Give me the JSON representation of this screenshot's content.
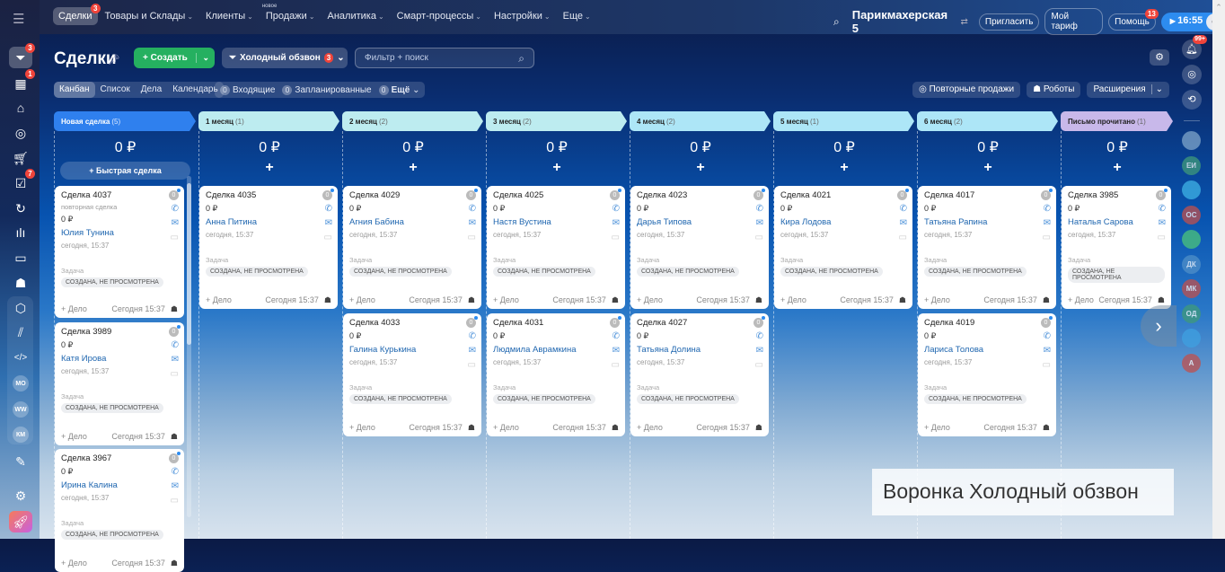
{
  "topnav": {
    "items": [
      {
        "label": "Сделки",
        "badge": "3",
        "active": true
      },
      {
        "label": "Товары и Склады",
        "chevron": true
      },
      {
        "label": "Клиенты",
        "chevron": true
      },
      {
        "label": "Продажи",
        "chevron": true,
        "tag": "новое"
      },
      {
        "label": "Аналитика",
        "chevron": true
      },
      {
        "label": "Смарт-процессы",
        "chevron": true
      },
      {
        "label": "Настройки",
        "chevron": true
      },
      {
        "label": "Еще",
        "chevron": true
      }
    ],
    "company": "Парикмахерская 5",
    "invite": "Пригласить",
    "tariff": "Мой тариф",
    "help": "Помощь",
    "help_badge": "13",
    "clock": "16:55"
  },
  "sidebar": {
    "deals_badge": "3",
    "tasks_badge": "1",
    "todo_badge": "7",
    "avatars": [
      "МО",
      "WW",
      "КМ"
    ]
  },
  "header": {
    "title": "Сделки",
    "create": "Создать",
    "funnel": "Холодный обзвон",
    "funnel_badge": "3",
    "search_placeholder": "Фильтр + поиск",
    "views": [
      "Канбан",
      "Список",
      "Дела",
      "Календарь"
    ],
    "counters": [
      {
        "n": "0",
        "label": "Входящие"
      },
      {
        "n": "0",
        "label": "Запланированные"
      },
      {
        "n": "0",
        "label": "Ещё"
      }
    ],
    "repeat_sales": "Повторные продажи",
    "robots": "Роботы",
    "extensions": "Расширения"
  },
  "columns": [
    {
      "title": "Новая сделка",
      "count": "(5)",
      "sum": "0 ₽",
      "color": "#2f80ee",
      "quick": "Быстрая сделка",
      "cards": [
        {
          "title": "Сделка 4037",
          "sub": "повторная сделка",
          "amount": "0 ₽",
          "contact": "Юлия Тунина",
          "date": "сегодня, 15:37",
          "task": "Задача",
          "status": "СОЗДАНА, НЕ ПРОСМОТРЕНА",
          "add": "+ Дело",
          "foot": "Сегодня 15:37",
          "counter": "0"
        },
        {
          "title": "Сделка 3989",
          "amount": "0 ₽",
          "contact": "Катя Ирова",
          "date": "сегодня, 15:37",
          "task": "Задача",
          "status": "СОЗДАНА, НЕ ПРОСМОТРЕНА",
          "add": "+ Дело",
          "foot": "Сегодня 15:37",
          "counter": "0"
        },
        {
          "title": "Сделка 3967",
          "amount": "0 ₽",
          "contact": "Ирина Калина",
          "date": "сегодня, 15:37",
          "task": "Задача",
          "status": "СОЗДАНА, НЕ ПРОСМОТРЕНА",
          "add": "+ Дело",
          "foot": "Сегодня 15:37",
          "counter": "0"
        }
      ]
    },
    {
      "title": "1 месяц",
      "count": "(1)",
      "sum": "0 ₽",
      "color": "#bdecf0",
      "cards": [
        {
          "title": "Сделка 4035",
          "amount": "0 ₽",
          "contact": "Анна Питина",
          "date": "сегодня, 15:37",
          "task": "Задача",
          "status": "СОЗДАНА, НЕ ПРОСМОТРЕНА",
          "add": "+ Дело",
          "foot": "Сегодня 15:37",
          "counter": "0"
        }
      ]
    },
    {
      "title": "2 месяц",
      "count": "(2)",
      "sum": "0 ₽",
      "color": "#bdecf0",
      "cards": [
        {
          "title": "Сделка 4029",
          "amount": "0 ₽",
          "contact": "Агния Бабина",
          "date": "сегодня, 15:37",
          "task": "Задача",
          "status": "СОЗДАНА, НЕ ПРОСМОТРЕНА",
          "add": "+ Дело",
          "foot": "Сегодня 15:37",
          "counter": "0"
        },
        {
          "title": "Сделка 4033",
          "amount": "0 ₽",
          "contact": "Галина Курькина",
          "date": "сегодня, 15:37",
          "task": "Задача",
          "status": "СОЗДАНА, НЕ ПРОСМОТРЕНА",
          "add": "+ Дело",
          "foot": "Сегодня 15:37",
          "counter": "0"
        }
      ]
    },
    {
      "title": "3 месяц",
      "count": "(2)",
      "sum": "0 ₽",
      "color": "#bdecf0",
      "cards": [
        {
          "title": "Сделка 4025",
          "amount": "0 ₽",
          "contact": "Настя Вустина",
          "date": "сегодня, 15:37",
          "task": "Задача",
          "status": "СОЗДАНА, НЕ ПРОСМОТРЕНА",
          "add": "+ Дело",
          "foot": "Сегодня 15:37",
          "counter": "0"
        },
        {
          "title": "Сделка 4031",
          "amount": "0 ₽",
          "contact": "Людмила Аврамкина",
          "date": "сегодня, 15:37",
          "task": "Задача",
          "status": "СОЗДАНА, НЕ ПРОСМОТРЕНА",
          "add": "+ Дело",
          "foot": "Сегодня 15:37",
          "counter": "0"
        }
      ]
    },
    {
      "title": "4 месяц",
      "count": "(2)",
      "sum": "0 ₽",
      "color": "#ade6f7",
      "cards": [
        {
          "title": "Сделка 4023",
          "amount": "0 ₽",
          "contact": "Дарья Типова",
          "date": "сегодня, 15:37",
          "task": "Задача",
          "status": "СОЗДАНА, НЕ ПРОСМОТРЕНА",
          "add": "+ Дело",
          "foot": "Сегодня 15:37",
          "counter": "0"
        },
        {
          "title": "Сделка 4027",
          "amount": "0 ₽",
          "contact": "Татьяна Долина",
          "date": "сегодня, 15:37",
          "task": "Задача",
          "status": "СОЗДАНА, НЕ ПРОСМОТРЕНА",
          "add": "+ Дело",
          "foot": "Сегодня 15:37",
          "counter": "0"
        }
      ]
    },
    {
      "title": "5 месяц",
      "count": "(1)",
      "sum": "0 ₽",
      "color": "#ade6f7",
      "cards": [
        {
          "title": "Сделка 4021",
          "amount": "0 ₽",
          "contact": "Кира Лодова",
          "date": "сегодня, 15:37",
          "task": "Задача",
          "status": "СОЗДАНА, НЕ ПРОСМОТРЕНА",
          "add": "+ Дело",
          "foot": "Сегодня 15:37",
          "counter": "0"
        }
      ]
    },
    {
      "title": "6 месяц",
      "count": "(2)",
      "sum": "0 ₽",
      "color": "#ade6f7",
      "cards": [
        {
          "title": "Сделка 4017",
          "amount": "0 ₽",
          "contact": "Татьяна Рапина",
          "date": "сегодня, 15:37",
          "task": "Задача",
          "status": "СОЗДАНА, НЕ ПРОСМОТРЕНА",
          "add": "+ Дело",
          "foot": "Сегодня 15:37",
          "counter": "0"
        },
        {
          "title": "Сделка 4019",
          "amount": "0 ₽",
          "contact": "Лариса Толова",
          "date": "сегодня, 15:37",
          "task": "Задача",
          "status": "СОЗДАНА, НЕ ПРОСМОТРЕНА",
          "add": "+ Дело",
          "foot": "Сегодня 15:37",
          "counter": "0"
        }
      ]
    },
    {
      "title": "Письмо прочитано",
      "count": "(1)",
      "sum": "0 ₽",
      "color": "#c8b8ea",
      "cards": [
        {
          "title": "Сделка 3985",
          "amount": "0 ₽",
          "contact": "Наталья Сарова",
          "date": "сегодня, 15:37",
          "task": "Задача",
          "status": "СОЗДАНА, НЕ ПРОСМОТРЕНА",
          "add": "+ Дело",
          "foot": "Сегодня 15:37",
          "counter": "0"
        }
      ]
    }
  ],
  "rightpanel": {
    "notif_badge": "99+",
    "avatars": [
      {
        "label": "",
        "color": "#7fa6c9"
      },
      {
        "label": "ЕИ",
        "color": "#3f9a7a"
      },
      {
        "label": "",
        "color": "#3fb3e6",
        "icon": "chat"
      },
      {
        "label": "ОС",
        "color": "#c0504d"
      },
      {
        "label": "",
        "color": "#4cc47a",
        "icon": "doc"
      },
      {
        "label": "ДК",
        "color": "#4f8fc8"
      },
      {
        "label": "МК",
        "color": "#c0504d"
      },
      {
        "label": "ОД",
        "color": "#3f9a7a"
      },
      {
        "label": "",
        "color": "#3fa0e0",
        "icon": "bookmark"
      },
      {
        "label": "А",
        "color": "#c0504d"
      }
    ]
  },
  "watermark": "Воронка Холодный обзвон"
}
